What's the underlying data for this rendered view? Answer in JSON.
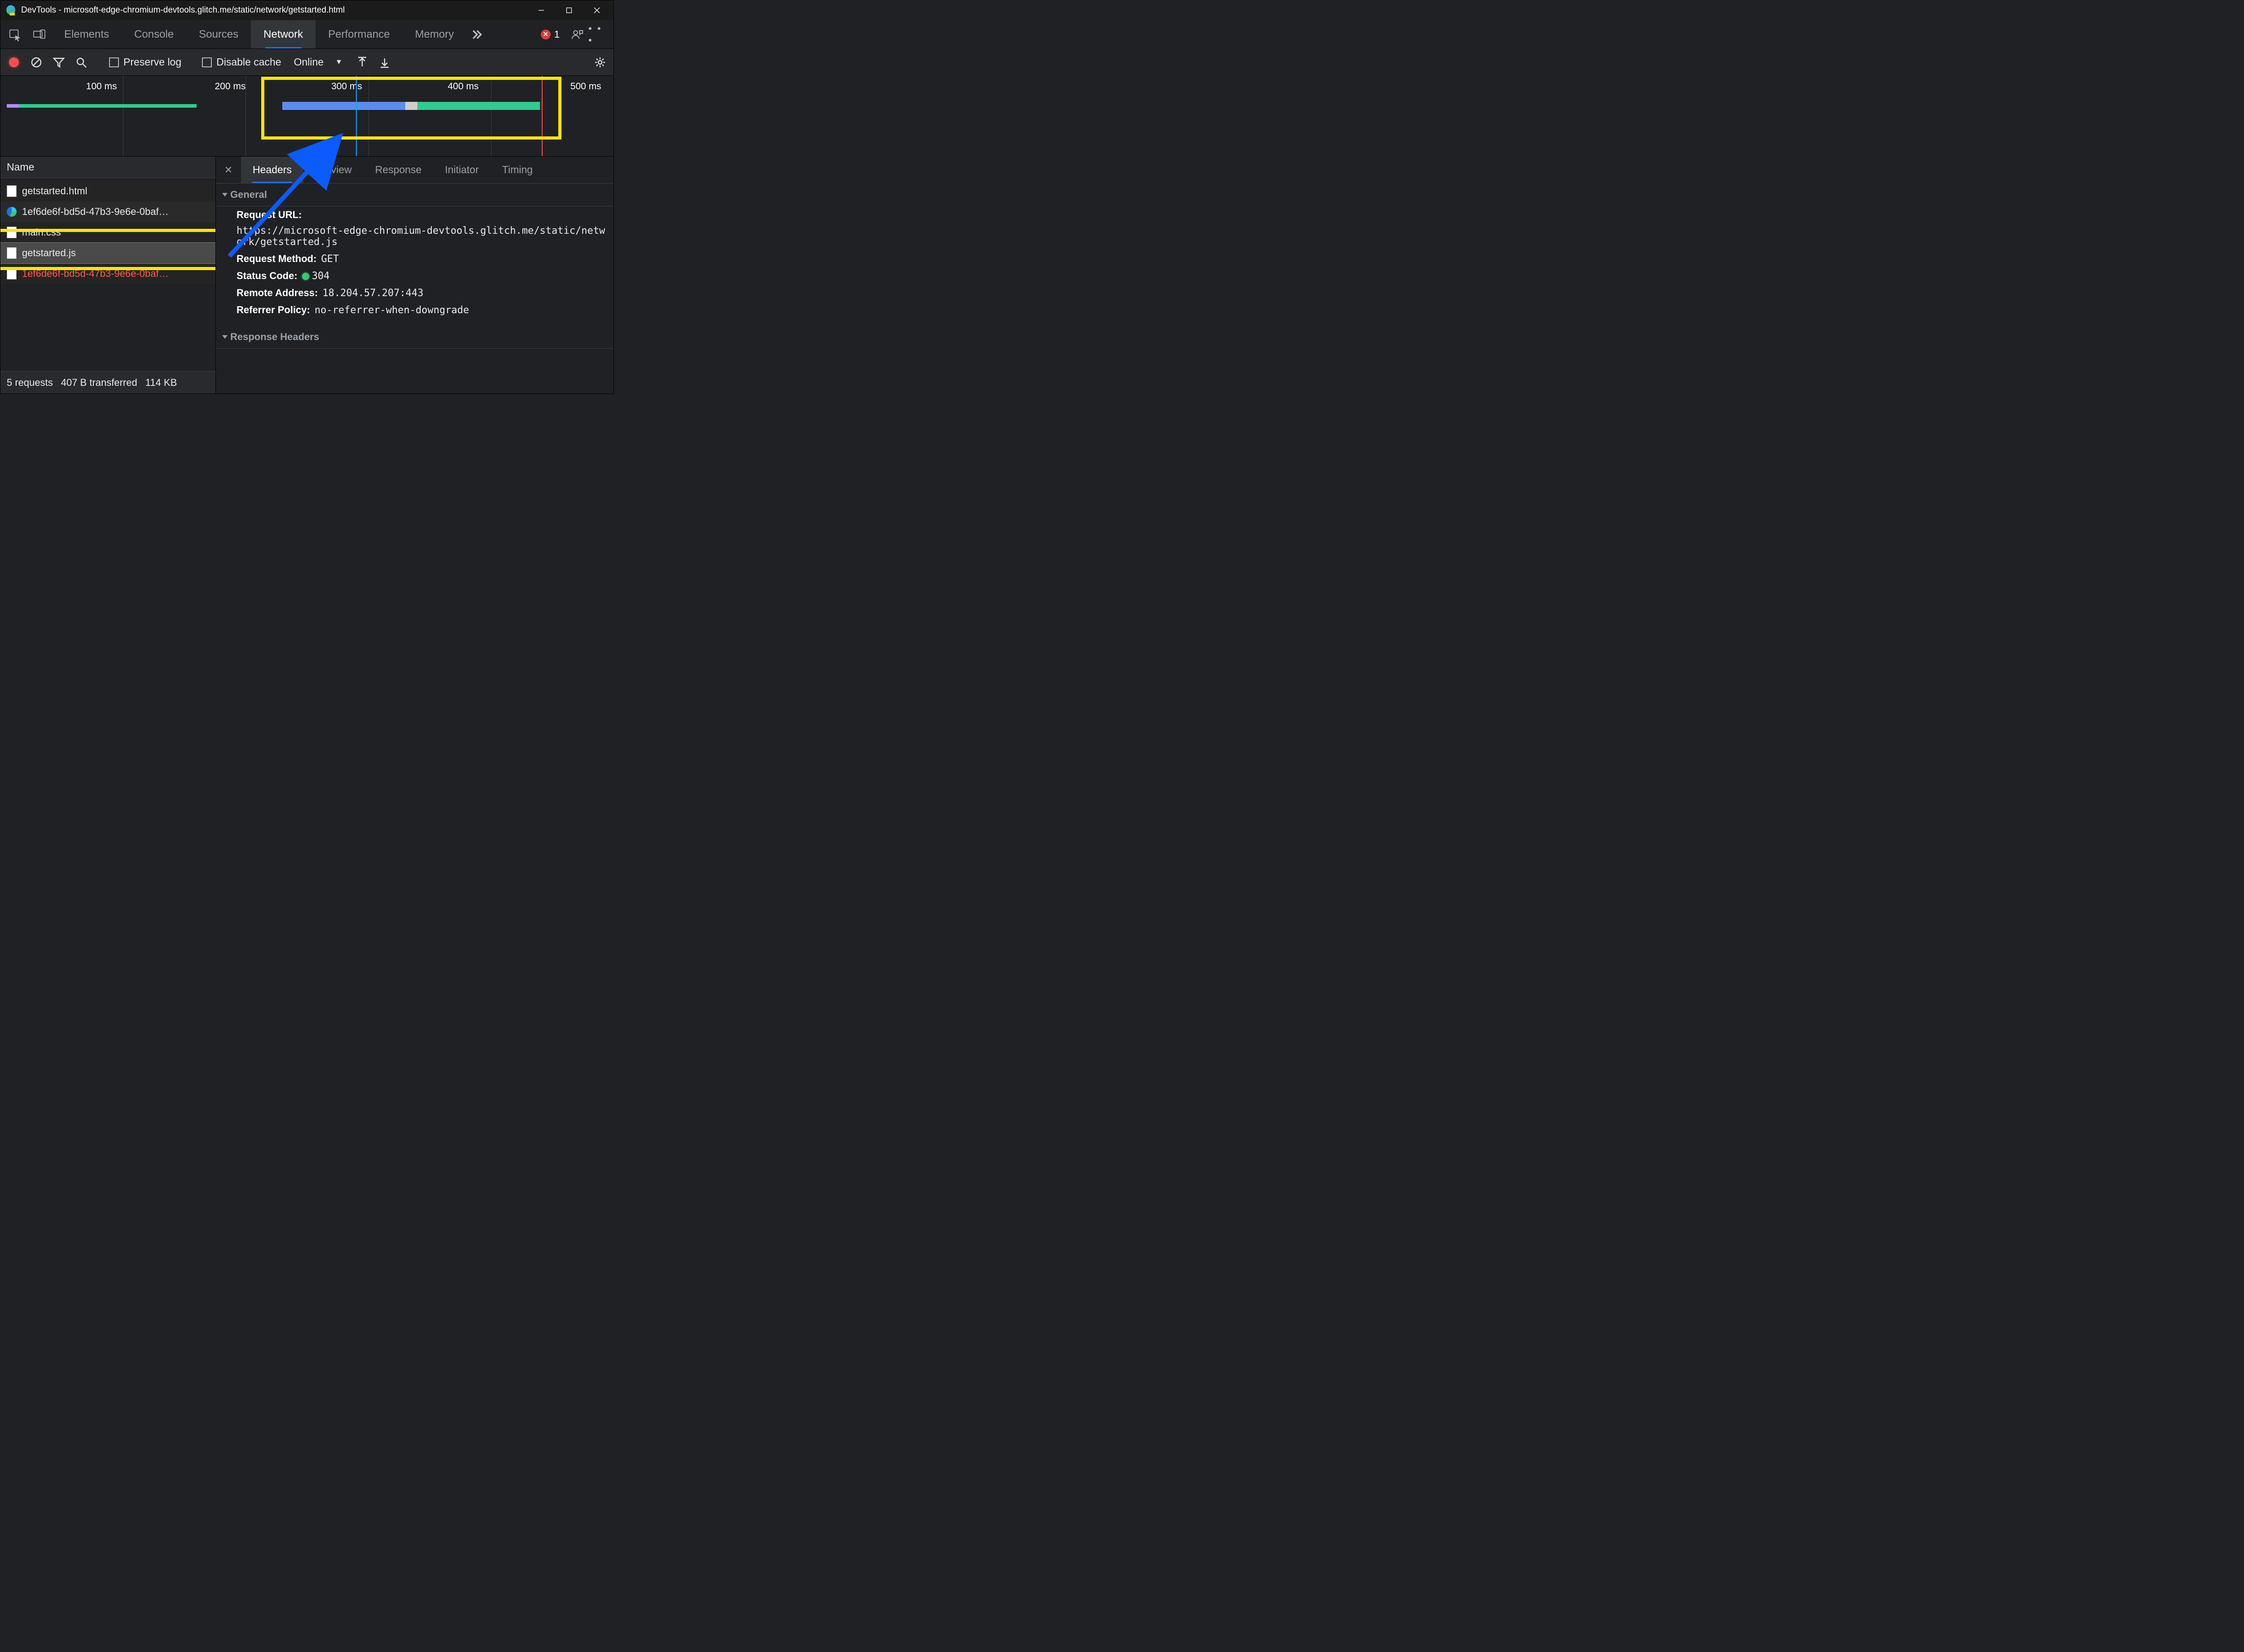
{
  "window": {
    "title": "DevTools - microsoft-edge-chromium-devtools.glitch.me/static/network/getstarted.html"
  },
  "mainTabs": {
    "items": [
      "Elements",
      "Console",
      "Sources",
      "Network",
      "Performance",
      "Memory"
    ],
    "active": "Network",
    "errorsCount": "1"
  },
  "networkToolbar": {
    "preserveLog": "Preserve log",
    "disableCache": "Disable cache",
    "throttling": "Online"
  },
  "overview": {
    "ticks": [
      "100 ms",
      "200 ms",
      "300 ms",
      "400 ms",
      "500 ms"
    ]
  },
  "requestTable": {
    "header": "Name",
    "rows": [
      {
        "name": "getstarted.html",
        "icon": "doc",
        "class": "",
        "sel": false
      },
      {
        "name": "1ef6de6f-bd5d-47b3-9e6e-0baf…",
        "icon": "edge",
        "class": "alt",
        "sel": false
      },
      {
        "name": "main.css",
        "icon": "doc",
        "class": "",
        "sel": false
      },
      {
        "name": "getstarted.js",
        "icon": "doc",
        "class": "alt",
        "sel": true
      },
      {
        "name": "1ef6de6f-bd5d-47b3-9e6e-0baf…",
        "icon": "doc",
        "class": "red",
        "sel": false
      }
    ]
  },
  "statusbar": {
    "requests": "5 requests",
    "transferred": "407 B transferred",
    "resources": "114 KB"
  },
  "detailsTabs": {
    "items": [
      "Headers",
      "Preview",
      "Response",
      "Initiator",
      "Timing"
    ],
    "active": "Headers"
  },
  "headers": {
    "generalTitle": "General",
    "requestUrlLabel": "Request URL:",
    "requestUrl": "https://microsoft-edge-chromium-devtools.glitch.me/static/network/getstarted.js",
    "requestMethodLabel": "Request Method:",
    "requestMethod": "GET",
    "statusCodeLabel": "Status Code:",
    "statusCode": "304",
    "remoteAddressLabel": "Remote Address:",
    "remoteAddress": "18.204.57.207:443",
    "referrerPolicyLabel": "Referrer Policy:",
    "referrerPolicy": "no-referrer-when-downgrade",
    "responseHeadersTitle": "Response Headers"
  }
}
